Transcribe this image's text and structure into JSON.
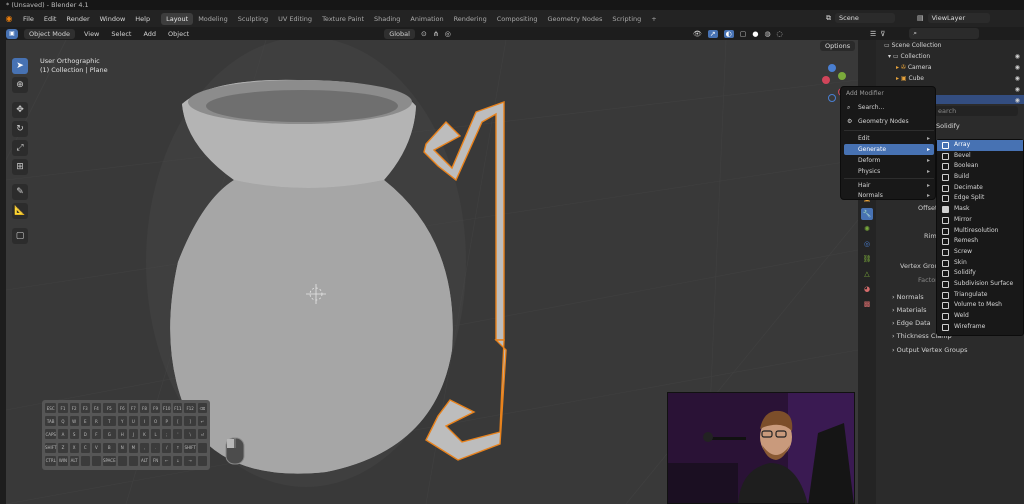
{
  "title": "* (Unsaved) - Blender 4.1",
  "menu": [
    "File",
    "Edit",
    "Render",
    "Window",
    "Help"
  ],
  "workspaces": [
    "Layout",
    "Modeling",
    "Sculpting",
    "UV Editing",
    "Texture Paint",
    "Shading",
    "Animation",
    "Rendering",
    "Compositing",
    "Geometry Nodes",
    "Scripting",
    "+"
  ],
  "scene": "Scene",
  "view_layer": "ViewLayer",
  "viewport": {
    "mode": "Object Mode",
    "menus": [
      "View",
      "Select",
      "Add",
      "Object"
    ],
    "orientation": "Global",
    "info_line1": "User Orthographic",
    "info_line2": "(1) Collection | Plane",
    "options": "Options"
  },
  "keyboard": {
    "keys": [
      "ESC",
      "F1",
      "F2",
      "F3",
      "F4",
      "F5",
      "F6",
      "F7",
      "F8",
      "F9",
      "F10",
      "F11",
      "F12",
      "⌫",
      "TAB",
      "Q",
      "W",
      "E",
      "R",
      "T",
      "Y",
      "U",
      "I",
      "O",
      "P",
      "[",
      "]",
      "↵",
      "CAPS",
      "A",
      "S",
      "D",
      "F",
      "G",
      "H",
      "J",
      "K",
      "L",
      ";",
      "'",
      "\\",
      "⏎",
      "SHIFT",
      "Z",
      "X",
      "C",
      "V",
      "B",
      "N",
      "M",
      ",",
      ".",
      "/",
      "↑",
      "SHIFT",
      "",
      "CTRL",
      "WIN",
      "ALT",
      "",
      "",
      "SPACE",
      "",
      "",
      "ALT",
      "FN",
      "←",
      "↓",
      "→",
      ""
    ]
  },
  "outliner": {
    "root": "Scene Collection",
    "collection": "Collection",
    "camera": "Camera",
    "cube": "Cube"
  },
  "add_modifier_menu": {
    "title": "Add Modifier",
    "search": "Search...",
    "geometry_nodes": "Geometry Nodes",
    "items": [
      "Edit",
      "Generate",
      "Deform",
      "Physics",
      "Hair",
      "Normals"
    ]
  },
  "generate_submenu": [
    "Array",
    "Bevel",
    "Boolean",
    "Build",
    "Decimate",
    "Edge Split",
    "Mask",
    "Mirror",
    "Multiresolution",
    "Remesh",
    "Screw",
    "Skin",
    "Solidify",
    "Subdivision Surface",
    "Triangulate",
    "Volume to Mesh",
    "Weld",
    "Wireframe"
  ],
  "properties": {
    "search_placeholder": "earch",
    "modifier_name": "Solidify",
    "offset_label": "Offset",
    "rim_label": "Rim",
    "vertex_group_label": "Vertex Group",
    "factor_label": "Factor",
    "sections": [
      "Normals",
      "Materials",
      "Edge Data",
      "Thickness Clamp",
      "Output Vertex Groups"
    ]
  }
}
